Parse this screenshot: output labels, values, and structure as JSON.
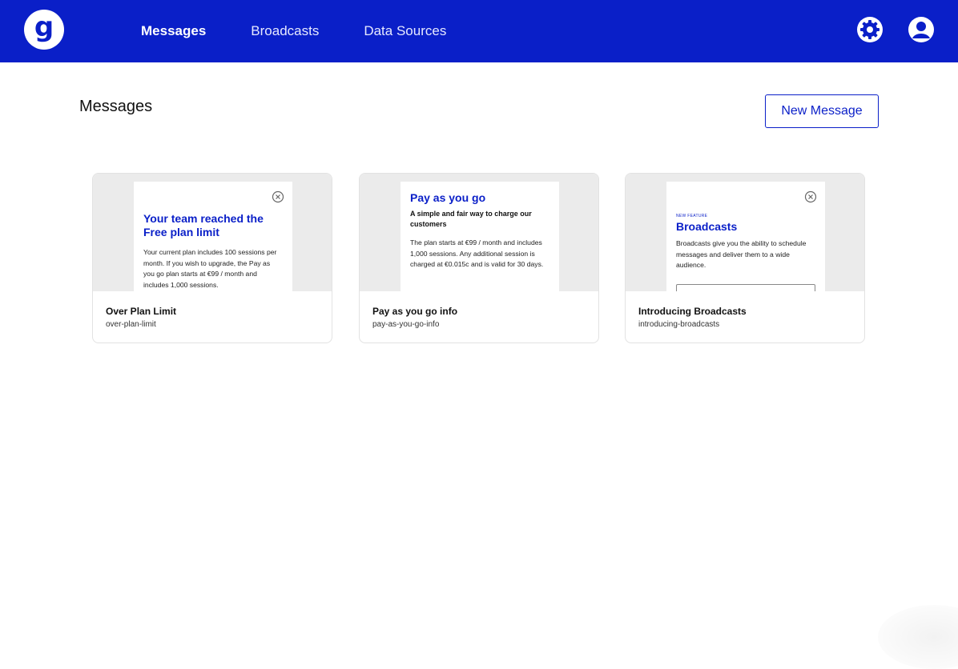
{
  "nav": {
    "logo_letter": "g",
    "items": [
      {
        "label": "Messages",
        "active": true
      },
      {
        "label": "Broadcasts",
        "active": false
      },
      {
        "label": "Data Sources",
        "active": false
      }
    ],
    "icons": [
      "gear-icon",
      "user-icon"
    ]
  },
  "page": {
    "title": "Messages",
    "new_button": "New Message"
  },
  "cards": [
    {
      "name": "Over Plan Limit",
      "slug": "over-plan-limit",
      "preview": {
        "heading": "Your team reached the Free plan limit",
        "body": "Your current plan includes 100 sessions per month. If you wish to upgrade, the Pay as you go plan starts at €99 / month and includes 1,000 sessions."
      }
    },
    {
      "name": "Pay as you go info",
      "slug": "pay-as-you-go-info",
      "preview": {
        "heading": "Pay as you go",
        "subheading": "A simple and fair way to charge our customers",
        "body": "The plan starts at €99 / month and includes 1,000 sessions. Any additional session is charged at €0.015c and is valid for 30 days."
      }
    },
    {
      "name": "Introducing Broadcasts",
      "slug": "introducing-broadcasts",
      "preview": {
        "eyebrow": "NEW FEATURE",
        "heading": "Broadcasts",
        "body": "Broadcasts give you the ability to schedule messages and deliver them to a wide audience."
      }
    }
  ],
  "colors": {
    "brand": "#0a1fc8",
    "preview_bg": "#ebebeb"
  }
}
